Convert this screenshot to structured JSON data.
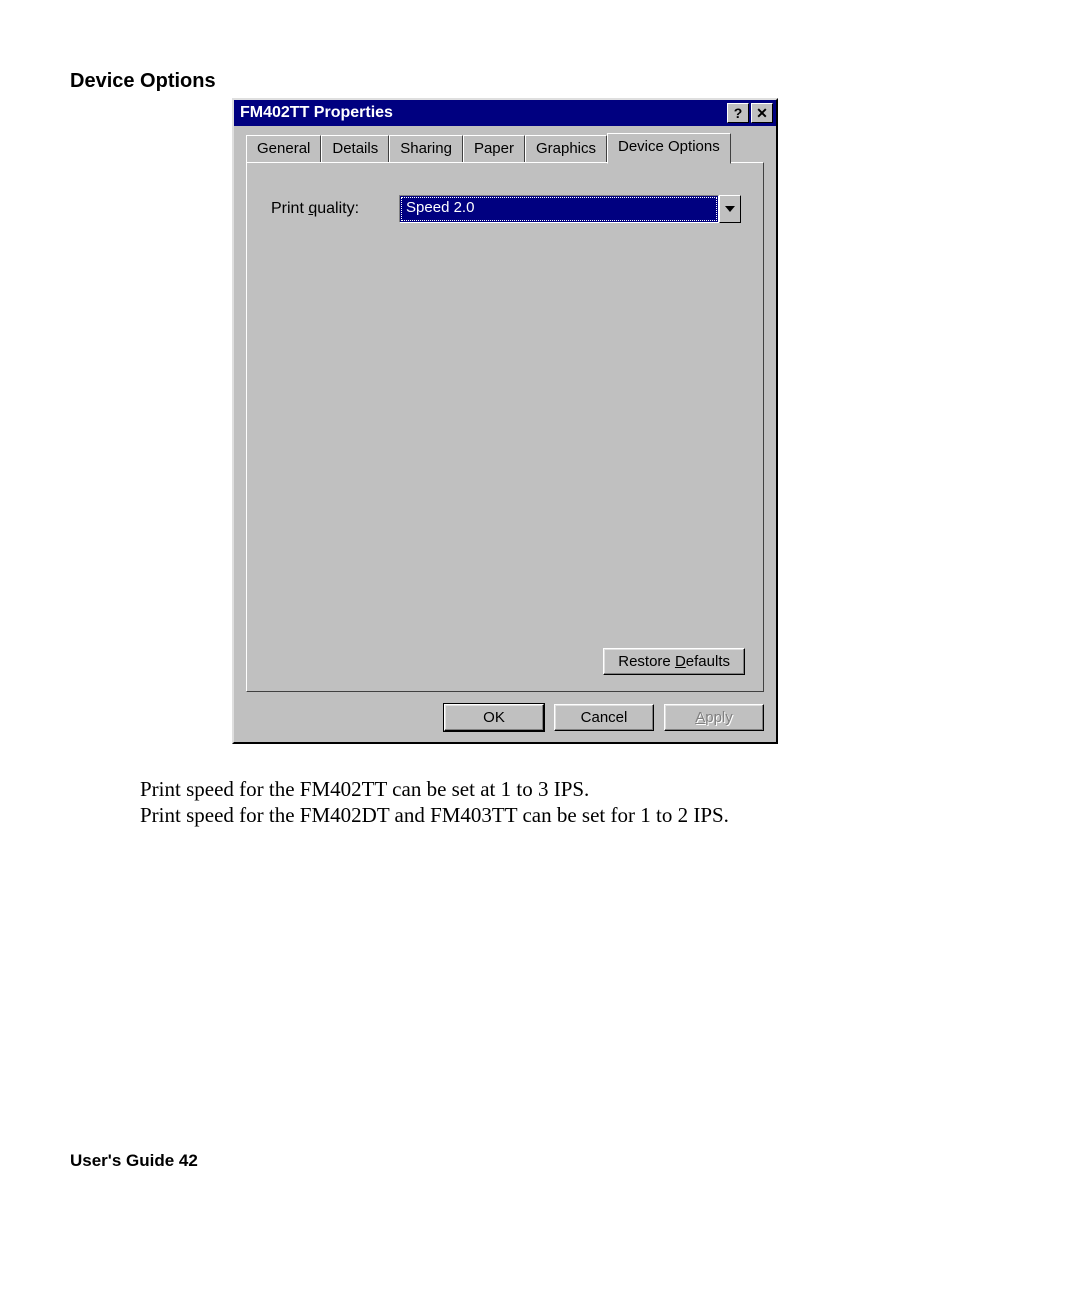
{
  "heading": "Device Options",
  "dialog": {
    "title": "FM402TT Properties",
    "tabs": [
      "General",
      "Details",
      "Sharing",
      "Paper",
      "Graphics",
      "Device Options"
    ],
    "active_tab_index": 5,
    "print_quality_label_pre": "Print ",
    "print_quality_label_u": "q",
    "print_quality_label_post": "uality:",
    "print_quality_value": "Speed 2.0",
    "restore_pre": "Restore ",
    "restore_u": "D",
    "restore_post": "efaults",
    "ok": "OK",
    "cancel": "Cancel",
    "apply_u": "A",
    "apply_post": "pply"
  },
  "body_line1": "Print speed for the FM402TT can be set at 1 to 3 IPS.",
  "body_line2": "Print speed for the FM402DT and FM403TT can be set for 1 to 2 IPS.",
  "footer": "User's Guide 42"
}
